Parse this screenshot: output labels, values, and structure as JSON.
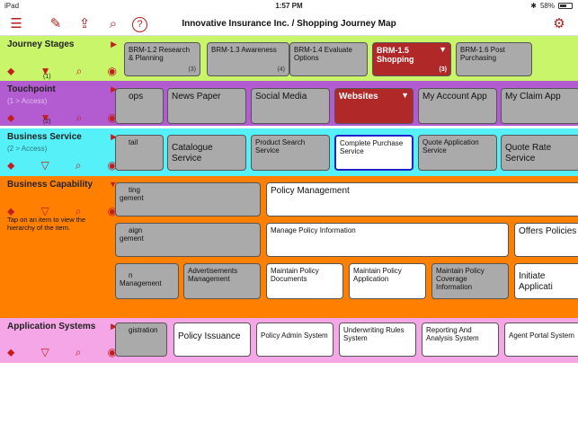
{
  "status_bar": {
    "device": "iPad",
    "time": "1:57 PM",
    "battery": "58%"
  },
  "toolbar": {
    "title": "Innovative Insurance Inc. / Shopping Journey Map"
  },
  "rows": {
    "stages": {
      "name": "Journey Stages",
      "filter_count": "(1)",
      "items": [
        {
          "label": "BRM-1.2 Research & Planning",
          "count": "(3)"
        },
        {
          "label": "BRM-1.3 Awareness",
          "count": "(4)"
        },
        {
          "label": "BRM-1.4 Evaluate Options",
          "count": ""
        },
        {
          "label": "BRM-1.5 Shopping",
          "count": "(3)"
        },
        {
          "label": "BRM-1.6 Post Purchasing",
          "count": ""
        }
      ]
    },
    "touchpoint": {
      "name": "Touchpoint",
      "sub": "(1 > Access)",
      "filter_count": "(2)",
      "items": [
        "ops",
        "News Paper",
        "Social Media",
        "Websites",
        "My Account App",
        "My Claim App"
      ]
    },
    "service": {
      "name": "Business Service",
      "sub": "(2 > Access)",
      "items": [
        "tail",
        "Catalogue Service",
        "Product Search Service",
        "Complete Purchase Service",
        "Quote Application Service",
        "Quote Rate Service"
      ]
    },
    "capability": {
      "name": "Business Capability",
      "note": "Tap on an item to view the hierarchy of the item.",
      "items": [
        "ting\ngement",
        "Policy Management",
        "aign\ngement",
        "Manage Policy Information",
        "Offers Policies",
        "n Management",
        "Advertisements Management",
        "Maintain Policy Documents",
        "Maintain Policy Application",
        "Maintain Policy Coverage Information",
        "Initiate Applicati"
      ]
    },
    "applications": {
      "name": "Application Systems",
      "items": [
        "gistration",
        "Policy Issuance",
        "Policy Admin System",
        "Underwriting Rules System",
        "Reporting And Analysis System",
        "Agent Portal System"
      ]
    }
  }
}
